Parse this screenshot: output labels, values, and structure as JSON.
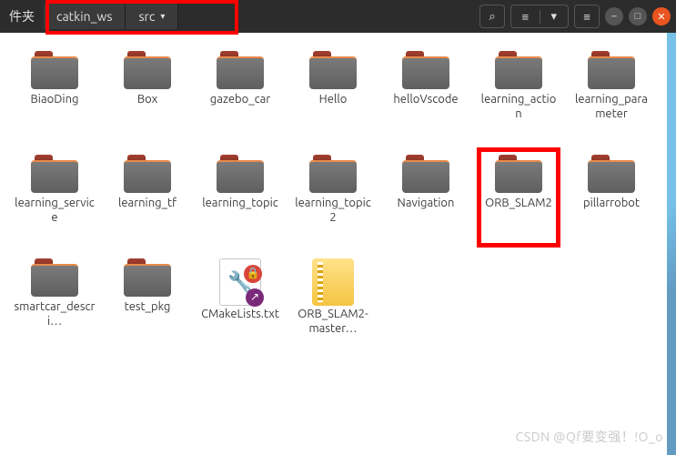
{
  "titlebar": {
    "title_fragment": "件夹",
    "crumb1": "catkin_ws",
    "crumb2": "src",
    "dropdown_glyph": "▾"
  },
  "icons": {
    "search": "⌕",
    "list": "≡",
    "down": "▾",
    "menu": "≡",
    "minimize": "–",
    "maximize": "□",
    "close": "✕",
    "wrench": "🔧",
    "lock": "🔒",
    "link": "↗"
  },
  "items": [
    {
      "label": "BiaoDing",
      "type": "folder"
    },
    {
      "label": "Box",
      "type": "folder"
    },
    {
      "label": "gazebo_car",
      "type": "folder"
    },
    {
      "label": "Hello",
      "type": "folder"
    },
    {
      "label": "helloVscode",
      "type": "folder"
    },
    {
      "label": "learning_action",
      "type": "folder"
    },
    {
      "label": "learning_parameter",
      "type": "folder"
    },
    {
      "label": "learning_service",
      "type": "folder"
    },
    {
      "label": "learning_tf",
      "type": "folder"
    },
    {
      "label": "learning_topic",
      "type": "folder"
    },
    {
      "label": "learning_topic2",
      "type": "folder"
    },
    {
      "label": "Navigation",
      "type": "folder"
    },
    {
      "label": "ORB_SLAM2",
      "type": "folder",
      "highlight": true
    },
    {
      "label": "pillarrobot",
      "type": "folder"
    },
    {
      "label": "smartcar_descri…",
      "type": "folder"
    },
    {
      "label": "test_pkg",
      "type": "folder"
    },
    {
      "label": "CMakeLists.txt",
      "type": "cmake"
    },
    {
      "label": "ORB_SLAM2-master…",
      "type": "zip"
    }
  ],
  "watermark": "CSDN @Qf要变强！!O_o"
}
